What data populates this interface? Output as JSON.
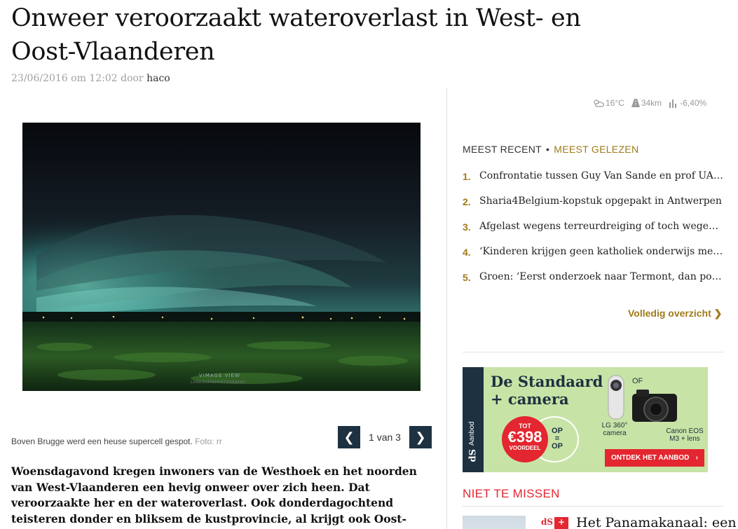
{
  "article": {
    "headline": "Onweer veroorzaakt wateroverlast in West- en Oost-Vlaanderen",
    "date": "23/06/2016 om 12:02",
    "by": "door",
    "author": "haco",
    "photo": {
      "watermark_line1": "VIMAGE VIEW",
      "watermark_line2": "LANDSCAPEPHOTOGRAPHY",
      "caption": "Boven Brugge werd een heuse supercell gespot.",
      "credit": "Foto: rr"
    },
    "pager": {
      "prev": "❮",
      "next": "❯",
      "count": "1 van 3"
    },
    "lead": "Woensdagavond kregen inwoners van de Westhoek en het noorden van West-Vlaanderen een hevig onweer over zich heen. Dat veroorzaakte her en der wateroverlast. Ook donderdagochtend teisteren donder en bliksem de kustprovincie, al krijgt ook Oost-Vlaanderen zijn deel."
  },
  "sidebar": {
    "weather": {
      "temperature": "16°C",
      "traffic": "34km",
      "stocks": "-6,40%"
    },
    "tabs": {
      "recent": "MEEST RECENT",
      "separator": "•",
      "popular": "MEEST GELEZEN"
    },
    "recent": [
      {
        "num": "1.",
        "title": "Confrontatie tussen Guy Van Sande en prof UA in ..."
      },
      {
        "num": "2.",
        "title": "Sharia4Belgium-kopstuk opgepakt in Antwerpen"
      },
      {
        "num": "3.",
        "title": "Afgelast wegens terreurdreiging of toch wegens gel..."
      },
      {
        "num": "4.",
        "title": "‘Kinderen krijgen geen katholiek onderwijs meer’"
      },
      {
        "num": "5.",
        "title": "Groen: ‘Eerst onderzoek naar Termont, dan positi..."
      }
    ],
    "overview_link": "Volledig overzicht ❯",
    "ad": {
      "side_label": "Aanbod",
      "side_logo": "dS",
      "title_line1": "De Standaard",
      "title_line2": "+ camera",
      "tot": "TOT",
      "price": "€398",
      "voordeel": "VOORDEEL",
      "op_line1": "OP",
      "op_line2": "=",
      "op_line3": "OP",
      "of": "OF",
      "camera1": "LG 360° camera",
      "camera2": "Canon EOS M3 + lens",
      "cta": "ONTDEK HET AANBOD",
      "cta_arrow": "›"
    },
    "not_to_miss": "NIET TE MISSEN",
    "teaser": {
      "logo_ds": "dS",
      "logo_plus": "+",
      "title": "Het Panamakanaal: een"
    }
  }
}
